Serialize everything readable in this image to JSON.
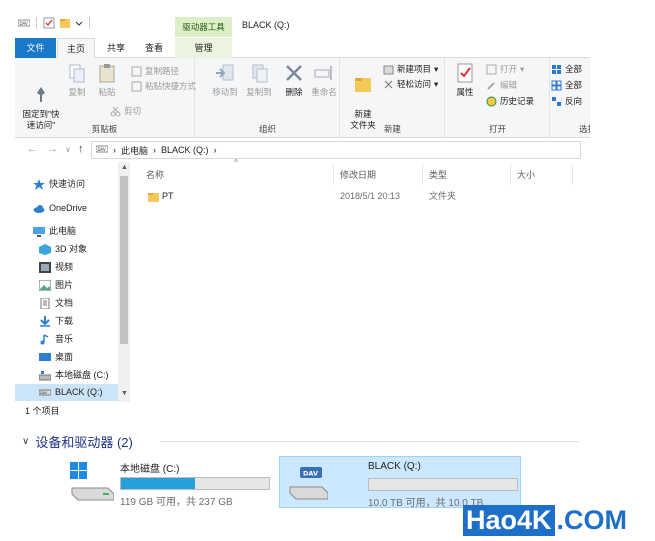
{
  "window": {
    "title": "BLACK (Q:)",
    "context_tab_header": "驱动器工具"
  },
  "ribbon_tabs": [
    {
      "label": "文件"
    },
    {
      "label": "主页"
    },
    {
      "label": "共享"
    },
    {
      "label": "查看"
    },
    {
      "label": "管理"
    }
  ],
  "ribbon": {
    "clipboard": {
      "label": "剪贴板",
      "pin": "固定到\"快\n速访问\"",
      "copy": "复制",
      "paste": "粘贴",
      "copy_path": "复制路径",
      "paste_shortcut": "粘贴快捷方式",
      "cut": "剪切"
    },
    "organize": {
      "label": "组织",
      "move_to": "移动到",
      "copy_to": "复制到",
      "delete": "删除",
      "rename": "重命名"
    },
    "new": {
      "label": "新建",
      "new_folder": "新建\n文件夹",
      "new_item": "新建项目",
      "easy_access": "轻松访问"
    },
    "open": {
      "label": "打开",
      "properties": "属性",
      "open": "打开",
      "edit": "编辑",
      "history": "历史记录"
    },
    "select": {
      "label": "选择",
      "select_all": "全部",
      "select_none": "全部",
      "invert": "反向"
    }
  },
  "address": {
    "crumbs": [
      "此电脑",
      "BLACK (Q:)"
    ]
  },
  "nav": {
    "items": [
      {
        "label": "快速访问",
        "icon": "star-icon"
      },
      {
        "label": "OneDrive",
        "icon": "cloud-icon"
      },
      {
        "label": "此电脑",
        "icon": "computer-icon"
      },
      {
        "label": "3D 对象",
        "icon": "cube-icon"
      },
      {
        "label": "视频",
        "icon": "video-icon"
      },
      {
        "label": "图片",
        "icon": "picture-icon"
      },
      {
        "label": "文档",
        "icon": "document-icon"
      },
      {
        "label": "下载",
        "icon": "download-icon"
      },
      {
        "label": "音乐",
        "icon": "music-icon"
      },
      {
        "label": "桌面",
        "icon": "desktop-icon"
      },
      {
        "label": "本地磁盘 (C:)",
        "icon": "disk-icon"
      },
      {
        "label": "BLACK (Q:)",
        "icon": "usb-drive-icon"
      }
    ]
  },
  "list": {
    "columns": [
      "名称",
      "修改日期",
      "类型",
      "大小"
    ],
    "rows": [
      {
        "name": "PT",
        "date": "2018/5/1 20:13",
        "type": "文件夹",
        "size": ""
      }
    ]
  },
  "status": "1 个项目",
  "devices": {
    "header": "设备和驱动器 (2)",
    "drives": [
      {
        "name": "本地磁盘 (C:)",
        "space": "119 GB 可用，共 237 GB",
        "used_fraction": 0.5
      },
      {
        "name": "BLACK (Q:)",
        "space": "10.0 TB 可用，共 10.0 TB",
        "used_fraction": 0.0
      }
    ]
  },
  "watermark": {
    "a": "Hao4K",
    "b": ".COM"
  },
  "colors": {
    "accent": "#1979ca",
    "selection": "#cce4f7",
    "bar_fill": "#26a0da"
  }
}
